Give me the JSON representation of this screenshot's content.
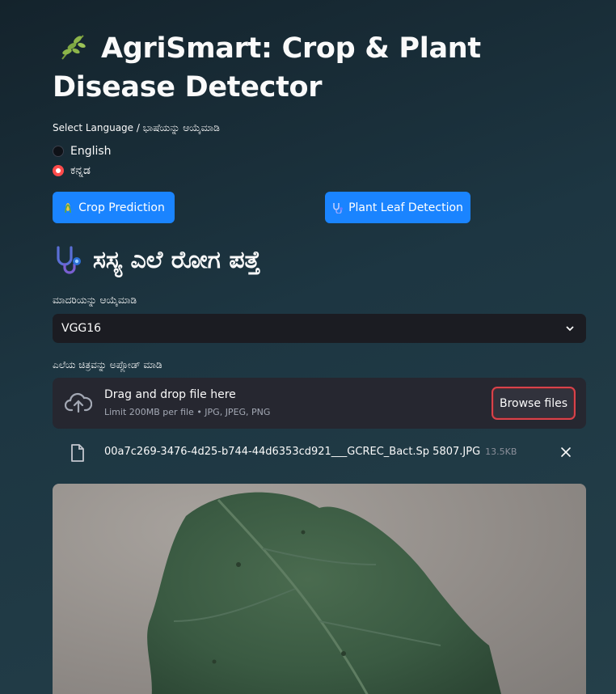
{
  "header": {
    "title": "AgriSmart: Crop & Plant Disease Detector",
    "icon": "herb-icon"
  },
  "language": {
    "label": "Select Language / ಭಾಷೆಯನ್ನು ಆಯ್ಕೆಮಾಡಿ",
    "options": [
      "English",
      "ಕನ್ನಡ"
    ],
    "selected": "ಕನ್ನಡ"
  },
  "nav": {
    "crop_label": "Crop Prediction",
    "leaf_label": "Plant Leaf Detection"
  },
  "section": {
    "title": "ಸಸ್ಯ ಎಲೆ ರೋಗ ಪತ್ತೆ",
    "icon": "stethoscope-icon"
  },
  "model": {
    "label": "ಮಾದರಿಯನ್ನು ಆಯ್ಕೆಮಾಡಿ",
    "value": "VGG16"
  },
  "upload": {
    "label": "ಎಲೆಯ ಚಿತ್ರವನ್ನು ಅಪ್ಲೋಡ್ ಮಾಡಿ",
    "drop_text": "Drag and drop file here",
    "limit_text": "Limit 200MB per file • JPG, JPEG, PNG",
    "browse_label": "Browse files"
  },
  "file": {
    "name": "00a7c269-3476-4d25-b744-44d6353cd921___GCREC_Bact.Sp 5807.JPG",
    "size": "13.5KB"
  },
  "colors": {
    "accent_blue": "#1a84ff",
    "radio_red": "#ff4b4b",
    "leaf_green": "#3f5f47"
  }
}
